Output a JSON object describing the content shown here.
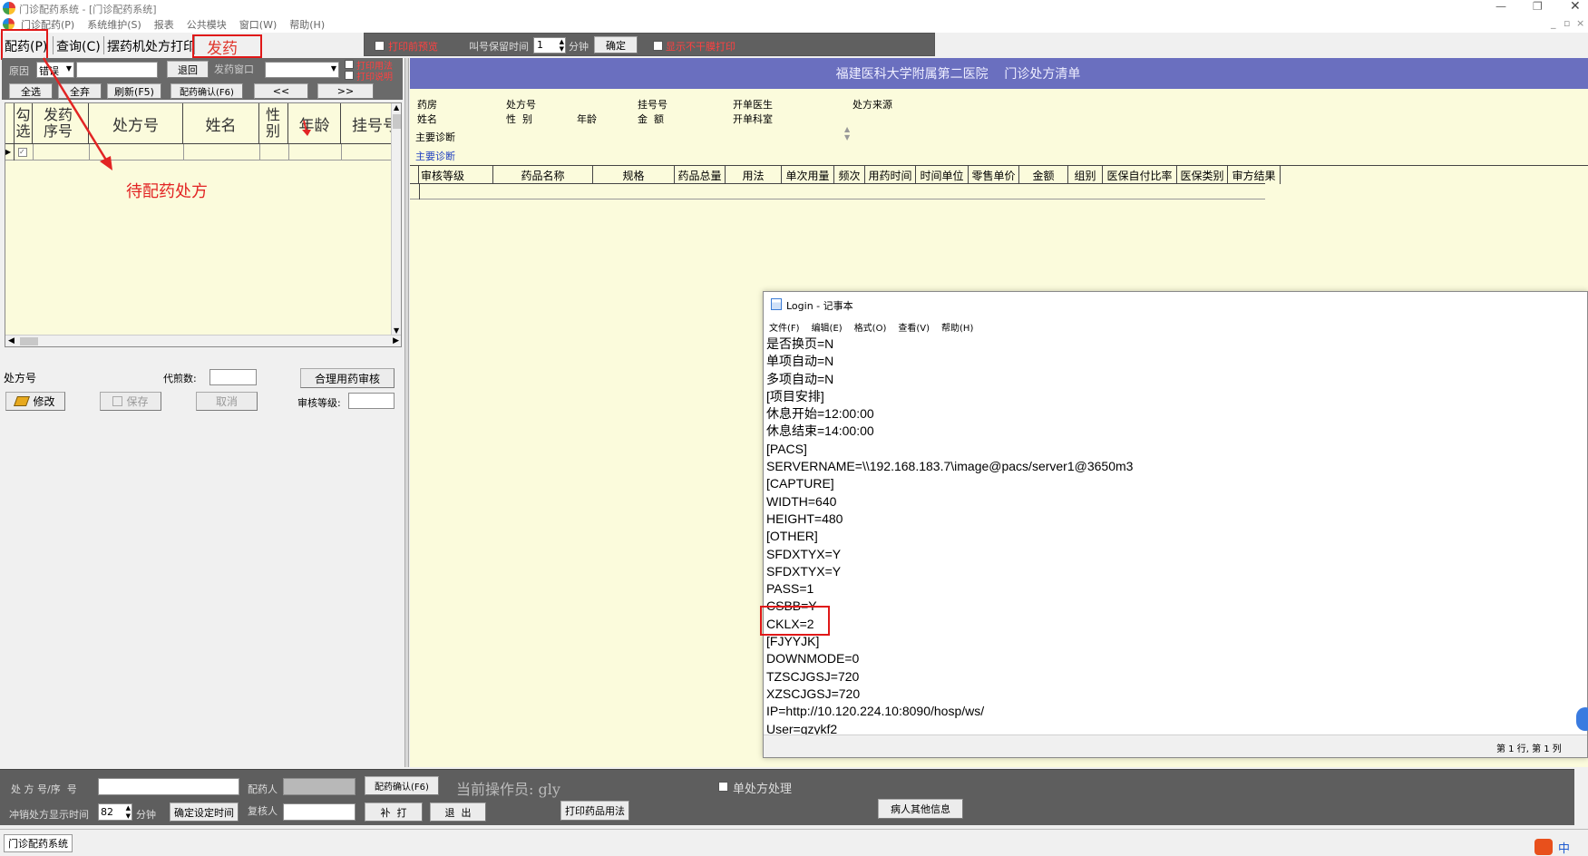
{
  "window": {
    "title": "门诊配药系统 - [门诊配药系统]",
    "menu": [
      "门诊配药(P)",
      "系统维护(S)",
      "报表",
      "公共模块",
      "窗口(W)",
      "帮助(H)"
    ]
  },
  "tabs": [
    "配药(P)",
    "查询(C)",
    "摆药机处方打印",
    "发药"
  ],
  "top_toolbar": {
    "print_preview": "打印前预览",
    "keep_time_label": "叫号保留时间",
    "keep_time_value": "1",
    "minute_label": "分钟",
    "confirm": "确定",
    "show_no_print": "显示不干膜打印"
  },
  "left": {
    "reason_label": "原因",
    "reason_value": "错误",
    "return_btn": "退回",
    "window_label": "发药窗口",
    "print_usage": "打印用法",
    "print_desc": "打印说明",
    "select_all": "全选",
    "deselect_all": "全弃",
    "refresh": "刷新(F5)",
    "confirm_dispense": "配药确认(F6)",
    "prev": "<<",
    "next": ">>",
    "columns": [
      "勾选",
      "发药序号",
      "处方号",
      "姓名",
      "性别",
      "年龄",
      "挂号号"
    ],
    "rx_label": "处方号",
    "decoct_label": "代煎数:",
    "rational_check": "合理用药审核",
    "edit_btn": "修改",
    "save_btn": "保存",
    "cancel_btn": "取消",
    "audit_level_label": "审核等级:"
  },
  "right": {
    "hospital_header": "福建医科大学附属第二医院    门诊处方清单",
    "info": {
      "pharmacy": "药房",
      "rx_no": "处方号",
      "reg_no": "挂号号",
      "doctor": "开单医生",
      "source": "处方来源",
      "name": "姓名",
      "sex": "性  别",
      "age": "年龄",
      "amount": "金  额",
      "dept": "开单科室",
      "main_diag": "主要诊断",
      "main_diag_link": "主要诊断"
    },
    "columns": [
      "审核等级",
      "药品名称",
      "规格",
      "药品总量",
      "用法",
      "单次用量",
      "频次",
      "用药时间",
      "时间单位",
      "零售单价",
      "金额",
      "组别",
      "医保自付比率",
      "医保类别",
      "审方结果"
    ]
  },
  "notepad": {
    "title": "Login - 记事本",
    "menu": [
      "文件(F)",
      "编辑(E)",
      "格式(O)",
      "查看(V)",
      "帮助(H)"
    ],
    "lines": [
      "是否换页=N",
      "单项自动=N",
      "多项自动=N",
      "[项目安排]",
      "休息开始=12:00:00",
      "休息结束=14:00:00",
      "[PACS]",
      "SERVERNAME=\\\\192.168.183.7\\image@pacs/server1@3650m3",
      "[CAPTURE]",
      "WIDTH=640",
      "HEIGHT=480",
      "[OTHER]",
      "SFDXTYX=Y",
      "SFDXTYX=Y",
      "PASS=1",
      "CSBB=Y",
      "CKLX=2",
      "[FJYYJK]",
      "DOWNMODE=0",
      "TZSCJGSJ=720",
      "XZSCJGSJ=720",
      "IP=http://10.120.224.10:8090/hosp/ws/",
      "User=qzykf2"
    ],
    "status": "第 1 行, 第 1 列"
  },
  "annotation": {
    "pending": "待配药处方"
  },
  "bottom": {
    "rx_seq_label": "处 方 号/序  号",
    "dispenser_label": "配药人",
    "confirm_btn": "配药确认(F6)",
    "operator": "当前操作员: gly",
    "single_rx": "单处方处理",
    "flush_label": "冲销处方显示时间",
    "flush_value": "82",
    "minute": "分钟",
    "set_time_btn": "确定设定时间",
    "reviewer_label": "复核人",
    "reprint_btn": "补  打",
    "exit_btn": "退  出",
    "print_usage_btn": "打印药品用法",
    "patient_info_btn": "病人其他信息"
  },
  "statusbar": {
    "app": "门诊配药系统",
    "ime": "中"
  }
}
